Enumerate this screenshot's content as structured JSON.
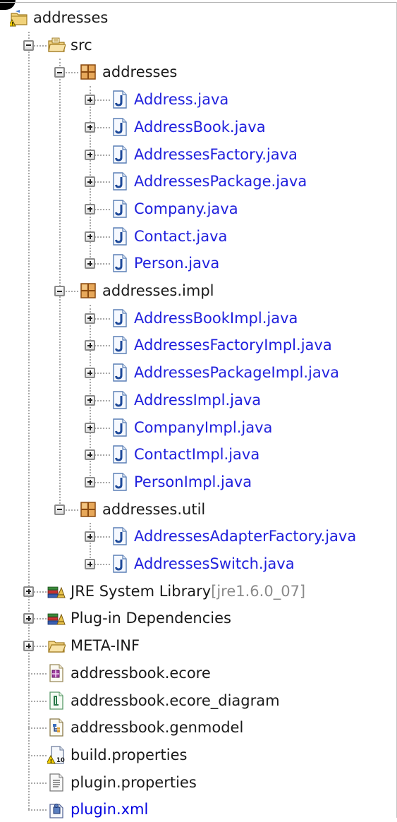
{
  "colors": {
    "java_link": "#2020dd",
    "text": "#1a1a1a",
    "dim_text": "#8a8a8a",
    "tree_line": "#a8a8a8",
    "package_icon": "#b8742a",
    "java_icon": "#3a6fbf"
  },
  "tree": [
    {
      "label": "addresses",
      "depth": 0,
      "toggle": "none",
      "icon": "project-folder-icon",
      "style": "normal"
    },
    {
      "label": "src",
      "depth": 1,
      "toggle": "minus",
      "icon": "source-folder-icon",
      "style": "normal"
    },
    {
      "label": "addresses",
      "depth": 2,
      "toggle": "minus",
      "icon": "package-icon",
      "style": "normal"
    },
    {
      "label": "Address.java",
      "depth": 3,
      "toggle": "plus",
      "icon": "java-file-icon",
      "style": "java"
    },
    {
      "label": "AddressBook.java",
      "depth": 3,
      "toggle": "plus",
      "icon": "java-file-icon",
      "style": "java"
    },
    {
      "label": "AddressesFactory.java",
      "depth": 3,
      "toggle": "plus",
      "icon": "java-file-icon",
      "style": "java"
    },
    {
      "label": "AddressesPackage.java",
      "depth": 3,
      "toggle": "plus",
      "icon": "java-file-icon",
      "style": "java"
    },
    {
      "label": "Company.java",
      "depth": 3,
      "toggle": "plus",
      "icon": "java-file-icon",
      "style": "java"
    },
    {
      "label": "Contact.java",
      "depth": 3,
      "toggle": "plus",
      "icon": "java-file-icon",
      "style": "java"
    },
    {
      "label": "Person.java",
      "depth": 3,
      "toggle": "plus",
      "icon": "java-file-icon",
      "style": "java"
    },
    {
      "label": "addresses.impl",
      "depth": 2,
      "toggle": "minus",
      "icon": "package-icon",
      "style": "normal"
    },
    {
      "label": "AddressBookImpl.java",
      "depth": 3,
      "toggle": "plus",
      "icon": "java-file-icon",
      "style": "java"
    },
    {
      "label": "AddressesFactoryImpl.java",
      "depth": 3,
      "toggle": "plus",
      "icon": "java-file-icon",
      "style": "java"
    },
    {
      "label": "AddressesPackageImpl.java",
      "depth": 3,
      "toggle": "plus",
      "icon": "java-file-icon",
      "style": "java"
    },
    {
      "label": "AddressImpl.java",
      "depth": 3,
      "toggle": "plus",
      "icon": "java-file-icon",
      "style": "java"
    },
    {
      "label": "CompanyImpl.java",
      "depth": 3,
      "toggle": "plus",
      "icon": "java-file-icon",
      "style": "java"
    },
    {
      "label": "ContactImpl.java",
      "depth": 3,
      "toggle": "plus",
      "icon": "java-file-icon",
      "style": "java"
    },
    {
      "label": "PersonImpl.java",
      "depth": 3,
      "toggle": "plus",
      "icon": "java-file-icon",
      "style": "java"
    },
    {
      "label": "addresses.util",
      "depth": 2,
      "toggle": "minus",
      "icon": "package-icon",
      "style": "normal"
    },
    {
      "label": "AddressesAdapterFactory.java",
      "depth": 3,
      "toggle": "plus",
      "icon": "java-file-icon",
      "style": "java"
    },
    {
      "label": "AddressesSwitch.java",
      "depth": 3,
      "toggle": "plus",
      "icon": "java-file-icon",
      "style": "java"
    },
    {
      "label": "JRE System Library",
      "suffix": "[jre1.6.0_07]",
      "depth": 1,
      "toggle": "plus",
      "icon": "library-icon",
      "style": "normal"
    },
    {
      "label": "Plug-in Dependencies",
      "depth": 1,
      "toggle": "plus",
      "icon": "library-icon",
      "style": "normal"
    },
    {
      "label": "META-INF",
      "depth": 1,
      "toggle": "plus",
      "icon": "folder-icon",
      "style": "normal"
    },
    {
      "label": "addressbook.ecore",
      "depth": 1,
      "toggle": "none",
      "icon": "ecore-file-icon",
      "style": "normal"
    },
    {
      "label": "addressbook.ecore_diagram",
      "depth": 1,
      "toggle": "none",
      "icon": "diagram-file-icon",
      "style": "normal"
    },
    {
      "label": "addressbook.genmodel",
      "depth": 1,
      "toggle": "none",
      "icon": "genmodel-file-icon",
      "style": "normal"
    },
    {
      "label": "build.properties",
      "depth": 1,
      "toggle": "none",
      "icon": "properties-warning-icon",
      "style": "normal"
    },
    {
      "label": "plugin.properties",
      "depth": 1,
      "toggle": "none",
      "icon": "text-file-icon",
      "style": "normal"
    },
    {
      "label": "plugin.xml",
      "depth": 1,
      "toggle": "none",
      "icon": "plugin-xml-icon",
      "style": "link"
    }
  ]
}
